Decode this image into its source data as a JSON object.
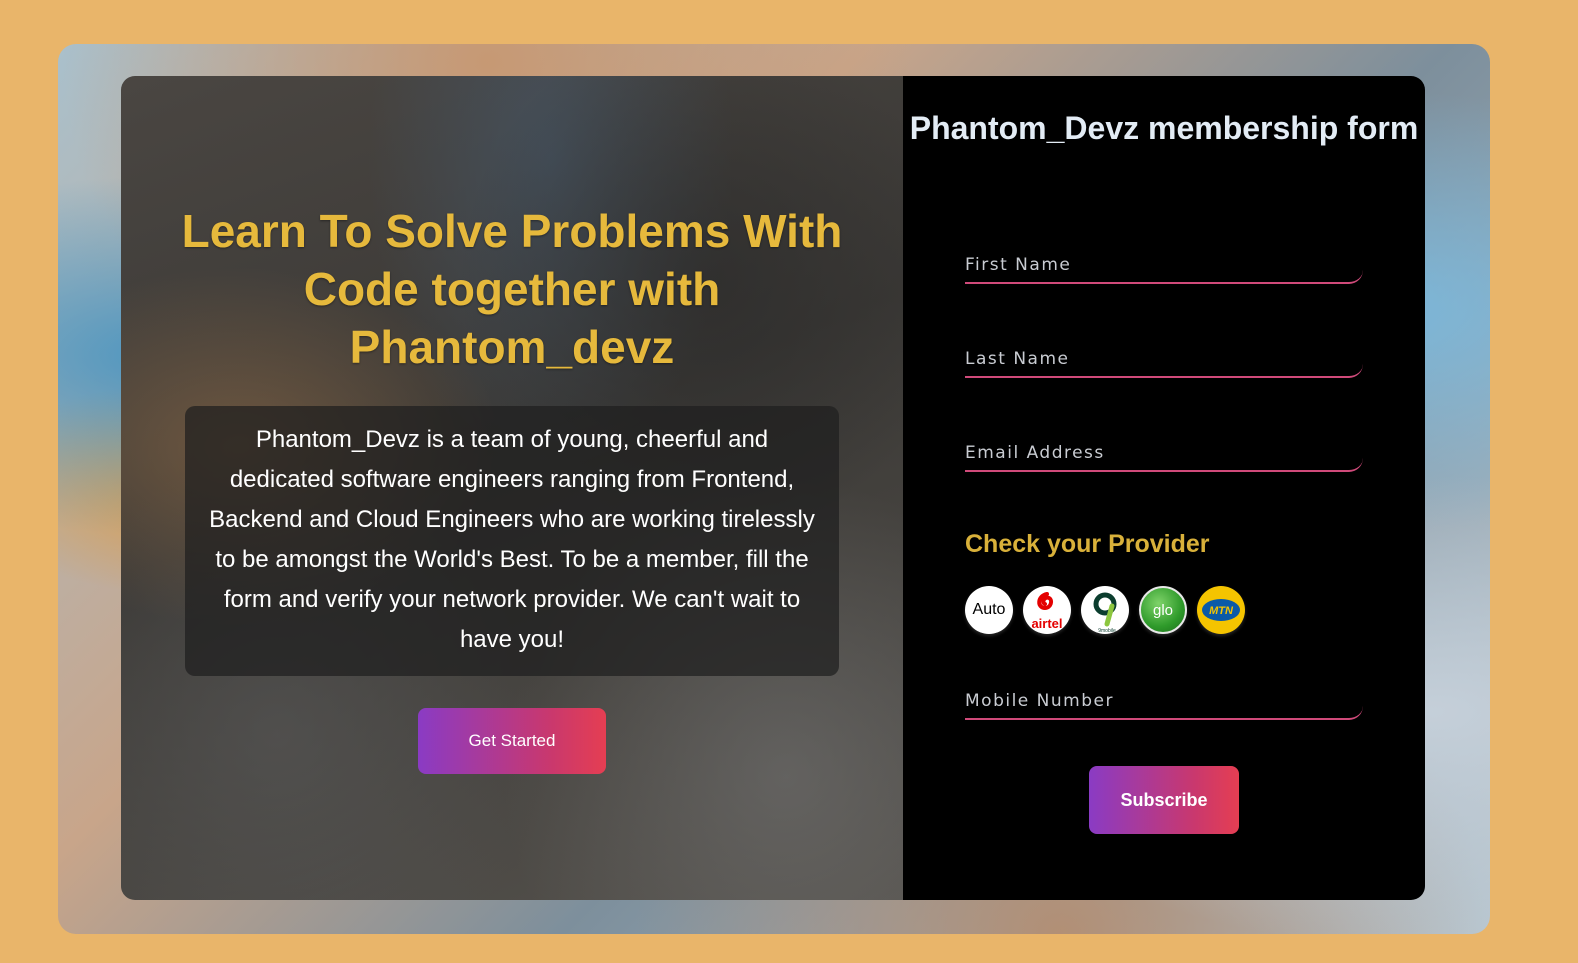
{
  "hero": {
    "headline": "Learn To Solve Problems With Code together with Phantom_devz",
    "description": "Phantom_Devz is a team of young, cheerful and dedicated software engineers ranging from Frontend, Backend and Cloud Engineers who are working tirelessly to be amongst the World's Best. To be a member, fill the form and verify your network provider. We can't wait to have you!",
    "cta_label": "Get Started"
  },
  "form": {
    "title": "Phantom_Devz membership form",
    "first_name": {
      "placeholder": "First Name",
      "value": ""
    },
    "last_name": {
      "placeholder": "Last Name",
      "value": ""
    },
    "email": {
      "placeholder": "Email Address",
      "value": ""
    },
    "provider_heading": "Check your Provider",
    "providers": [
      {
        "label": "Auto",
        "icon": "auto-icon"
      },
      {
        "label": "airtel",
        "icon": "airtel-logo-icon"
      },
      {
        "label": "9mobile",
        "icon": "9mobile-logo-icon"
      },
      {
        "label": "glo",
        "icon": "glo-logo-icon"
      },
      {
        "label": "MTN",
        "icon": "mtn-logo-icon"
      }
    ],
    "mobile": {
      "placeholder": "Mobile Number",
      "value": ""
    },
    "submit_label": "Subscribe"
  },
  "colors": {
    "page_background": "#e9b56a",
    "headline": "#e6b93c",
    "provider_heading": "#d9b13a",
    "field_underline": "#d04a7a",
    "button_gradient_start": "#8a3bc4",
    "button_gradient_end": "#e53e52"
  }
}
